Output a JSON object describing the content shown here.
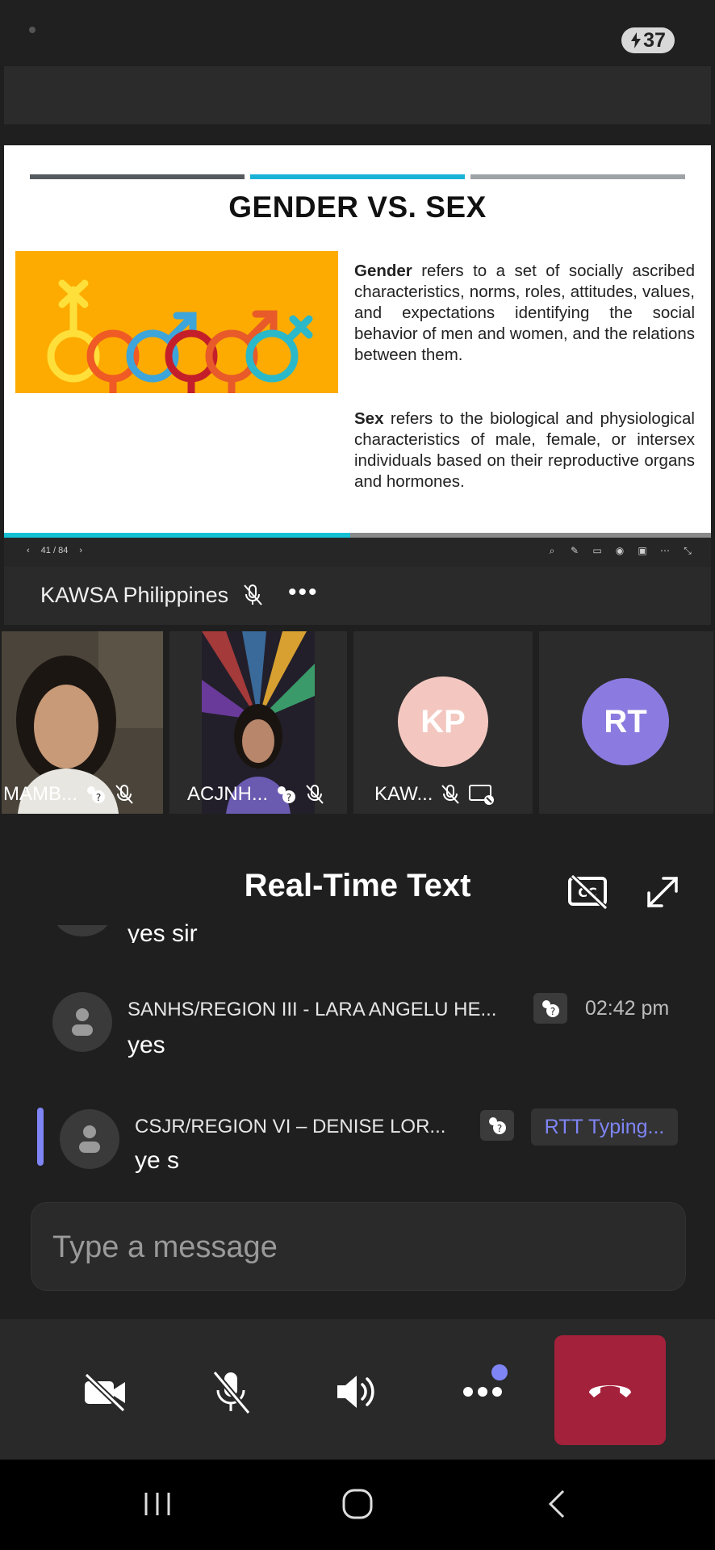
{
  "status_bar": {
    "battery_level": "37"
  },
  "slide": {
    "title": "GENDER VS. SEX",
    "gender_term": "Gender",
    "gender_def": " refers to a set of socially ascribed characteristics, norms, roles, attitudes, values, and expectations identifying the social behavior of men and women, and the relations between them.",
    "sex_term": "Sex",
    "sex_def": " refers to the biological and physiological characteristics of male, female, or intersex individuals based on their reproductive organs and hormones.",
    "page_indicator": "41 / 84",
    "progress": 0.49,
    "colors": {
      "art_bg": "#fdab00",
      "bar1": "#555b5e",
      "bar2": "#1ab1d6",
      "bar3": "#9ea3a6"
    }
  },
  "presenter": {
    "name": "KAWSA Philippines",
    "more": "•••"
  },
  "tiles": [
    {
      "label": "MAMB...",
      "type": "video"
    },
    {
      "label": "ACJNH...",
      "type": "video"
    },
    {
      "label": "KAW...",
      "initials": "KP",
      "avatar_color": "#f3c7c0",
      "text_color": "#ffffff"
    },
    {
      "initials": "RT",
      "avatar_color": "#8b7be0",
      "text_color": "#ffffff"
    }
  ],
  "rtt": {
    "title": "Real-Time Text",
    "messages": [
      {
        "text": "yes sir"
      },
      {
        "name": "SANHS/REGION III - LARA ANGELU HE...",
        "time": "02:42 pm",
        "text": "yes"
      },
      {
        "name": "CSJR/REGION VI – DENISE LOR...",
        "status": "RTT Typing...",
        "text": "ye s"
      }
    ],
    "input_placeholder": "Type a message"
  },
  "controls": {
    "camera": "camera-off-icon",
    "mic": "mic-off-icon",
    "speaker": "speaker-icon",
    "more": "more-options-icon",
    "hangup": "hang-up-icon",
    "accent_color": "#7f85f5",
    "hangup_color": "#a4213b"
  },
  "nav": {
    "recent": "recent-apps-icon",
    "home": "home-icon",
    "back": "back-icon"
  }
}
